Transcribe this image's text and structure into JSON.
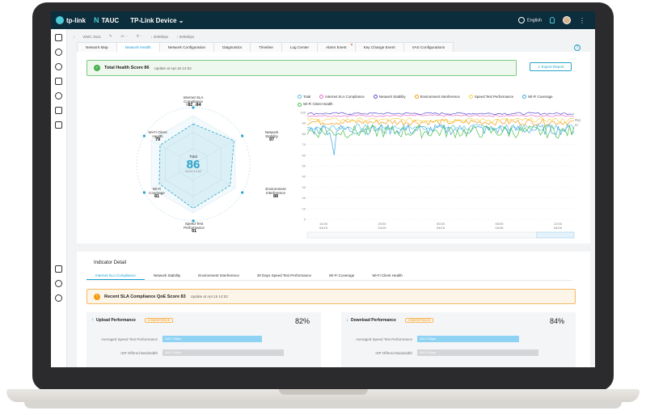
{
  "topbar": {
    "logo_text": "tp-link",
    "product": "TAUC",
    "device_selector": "TP-Link Device",
    "language": "English"
  },
  "breadcrumb": {
    "device": "WMC 2621",
    "download": "300Mbps",
    "upload": "500Mbps"
  },
  "tabs": [
    "Network Map",
    "Network Health",
    "Network Configuration",
    "Diagnostics",
    "Timeline",
    "Log Center",
    "Alarm Event",
    "Key Change Event",
    "VAS Configurations"
  ],
  "health": {
    "title": "Total Health Score 86",
    "time": "Update at Apr.16 14:53",
    "export_label": "Export Report"
  },
  "radar": {
    "total_label": "Total",
    "total_score": "86",
    "total_time": "04/16 14:53",
    "axes": [
      {
        "name": "Internet SLA Compliance",
        "line1": "Internet SLA",
        "line2": "Compliance",
        "value_text": "↑82 ↓84",
        "value": 83
      },
      {
        "name": "Network Stability",
        "line1": "Network",
        "line2": "Stability",
        "value_text": "97",
        "value": 97
      },
      {
        "name": "Environment Interference",
        "line1": "Environment",
        "line2": "Interference",
        "value_text": "88",
        "value": 88
      },
      {
        "name": "Speed Test Performance",
        "line1": "Speed Test",
        "line2": "Performance",
        "value_text": "91",
        "value": 91
      },
      {
        "name": "Wi-Fi Coverage",
        "line1": "Wi-Fi",
        "line2": "Coverage",
        "value_text": "81",
        "value": 81
      },
      {
        "name": "Wi-Fi Client Health",
        "line1": "Wi-Fi Client",
        "line2": "Health",
        "value_text": "79",
        "value": 79
      }
    ]
  },
  "chart_data": {
    "type": "line",
    "x": [
      "14:00 04/15",
      "20:00 04/15",
      "00:00 04/16",
      "06:00 04/16",
      "12:00 04/16"
    ],
    "ylim": [
      0,
      100
    ],
    "y_ticks": [
      0,
      10,
      20,
      30,
      40,
      50,
      60,
      70,
      80,
      90,
      100
    ],
    "x_ticks": [
      {
        "time": "14:00",
        "date": "04/15"
      },
      {
        "time": "20:00",
        "date": "04/15"
      },
      {
        "time": "00:00",
        "date": "04/16"
      },
      {
        "time": "06:00",
        "date": "04/16"
      },
      {
        "time": "12:00",
        "date": "04/16"
      }
    ],
    "annotation": {
      "label": "Avg:",
      "value": "97"
    },
    "series": [
      {
        "name": "Total",
        "color": "#5bc0de",
        "base": 86,
        "amp": 3
      },
      {
        "name": "Internet SLA Compliance",
        "color": "#e66fc8",
        "base": 97,
        "amp": 1
      },
      {
        "name": "Network Stability",
        "color": "#5a4fcf",
        "base": 99,
        "amp": 1
      },
      {
        "name": "Environment Interference",
        "color": "#f39c12",
        "base": 91,
        "amp": 3
      },
      {
        "name": "Speed Test Performance",
        "color": "#f6d24a",
        "base": 93,
        "amp": 2
      },
      {
        "name": "Wi-Fi Coverage",
        "color": "#3fa7e0",
        "base": 84,
        "amp": 5
      },
      {
        "name": "Wi-Fi Client Health",
        "color": "#4cbf4f",
        "base": 82,
        "amp": 6
      }
    ]
  },
  "indicator": {
    "title": "Indicator Detail",
    "tabs": [
      "Internet SLA Compliance",
      "Network Stability",
      "Environment Interference",
      "30 Days Speed Test Performance",
      "Wi-Fi Coverage",
      "Wi-Fi Client Health"
    ],
    "sla_title": "Recent SLA Compliance QoE Score 83",
    "sla_time": "Update at Apr.16 14:53",
    "upload": {
      "title": "Upload Performance",
      "badge": "CONSISTENCE",
      "percent": "82%",
      "avg_label": "Averaged Speed Test Performance",
      "avg_value": "246.7 Mbps",
      "avg_fraction": 0.82,
      "isp_label": "ISP Offered Bandwidth",
      "isp_value": "300.0 Mbps",
      "isp_fraction": 1.0
    },
    "download": {
      "title": "Download Performance",
      "badge": "CONSISTENCE",
      "percent": "84%",
      "avg_label": "Averaged Speed Test Performance",
      "avg_value": "420.2 Mbps",
      "avg_fraction": 0.84,
      "isp_label": "ISP Offered Bandwidth",
      "isp_value": "500.0 Mbps",
      "isp_fraction": 1.0
    }
  },
  "colors": {
    "accent": "#1a9fd6",
    "topbar": "#0c2d3c",
    "success": "#4caf50",
    "warning": "#f39c12",
    "bar_avg": "#8fd3f4",
    "bar_isp": "#d3d5d8"
  }
}
